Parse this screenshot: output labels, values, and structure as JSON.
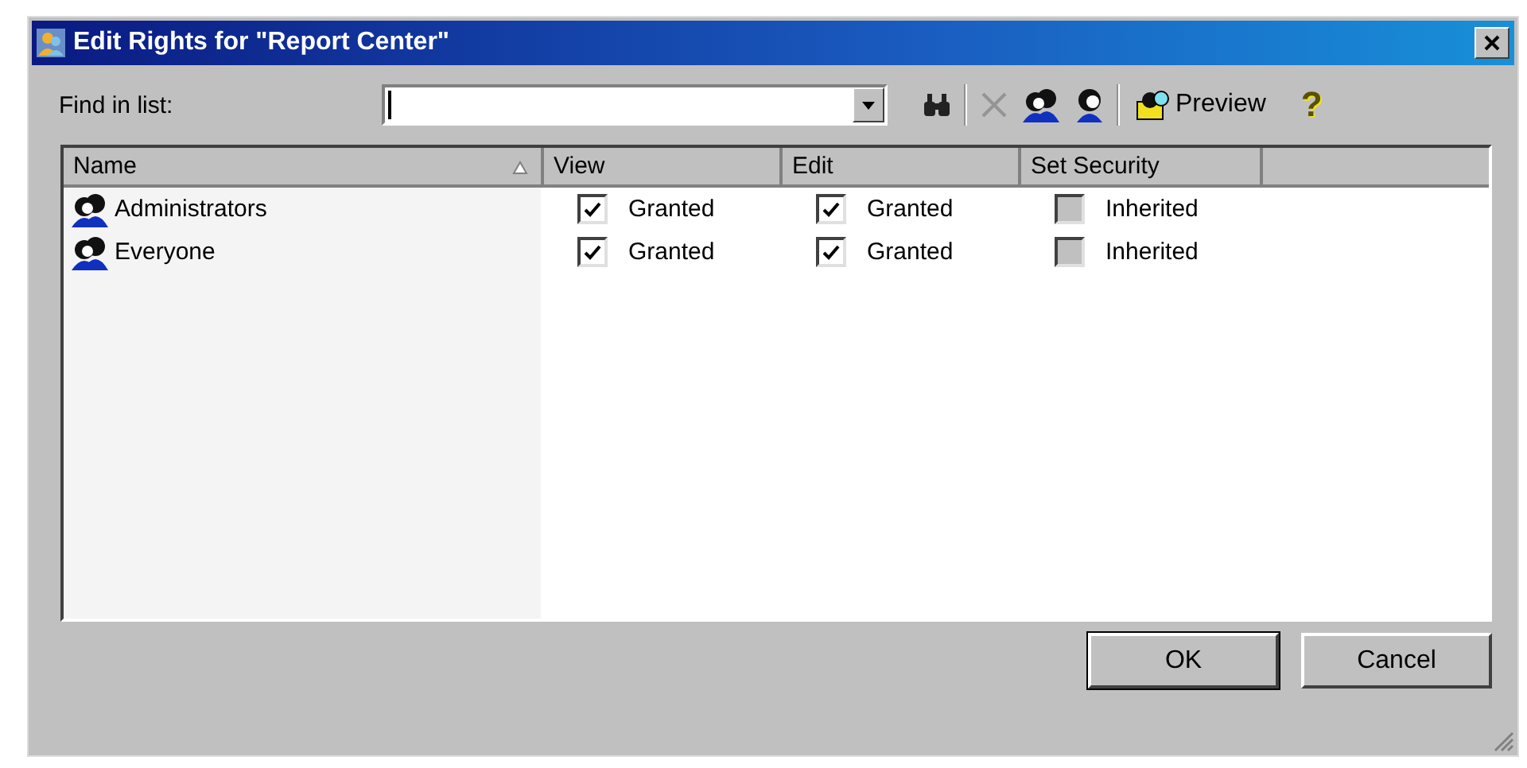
{
  "window": {
    "title": "Edit Rights for \"Report Center\""
  },
  "find": {
    "label": "Find in list:"
  },
  "toolbar": [
    {
      "kind": "find"
    },
    {
      "kind": "separator"
    },
    {
      "kind": "delete",
      "disabled": true
    },
    {
      "kind": "group"
    },
    {
      "kind": "user"
    },
    {
      "kind": "separator"
    },
    {
      "kind": "preview",
      "label": "Preview"
    },
    {
      "kind": "help",
      "label": "?"
    }
  ],
  "table": {
    "columns": [
      {
        "label": "Name",
        "sorted": true
      },
      {
        "label": "View",
        "sorted": false
      },
      {
        "label": "Edit",
        "sorted": false
      },
      {
        "label": "Set Security",
        "sorted": false
      }
    ],
    "rows": [
      {
        "name": "Administrators",
        "cells": [
          {
            "label": "Granted",
            "checked": true,
            "disabled": false
          },
          {
            "label": "Granted",
            "checked": true,
            "disabled": false
          },
          {
            "label": "Inherited",
            "checked": false,
            "disabled": true
          }
        ]
      },
      {
        "name": "Everyone",
        "cells": [
          {
            "label": "Granted",
            "checked": true,
            "disabled": false
          },
          {
            "label": "Granted",
            "checked": true,
            "disabled": false
          },
          {
            "label": "Inherited",
            "checked": false,
            "disabled": true
          }
        ]
      }
    ]
  },
  "buttons": [
    {
      "label": "OK",
      "default": true
    },
    {
      "label": "Cancel",
      "default": false
    }
  ]
}
